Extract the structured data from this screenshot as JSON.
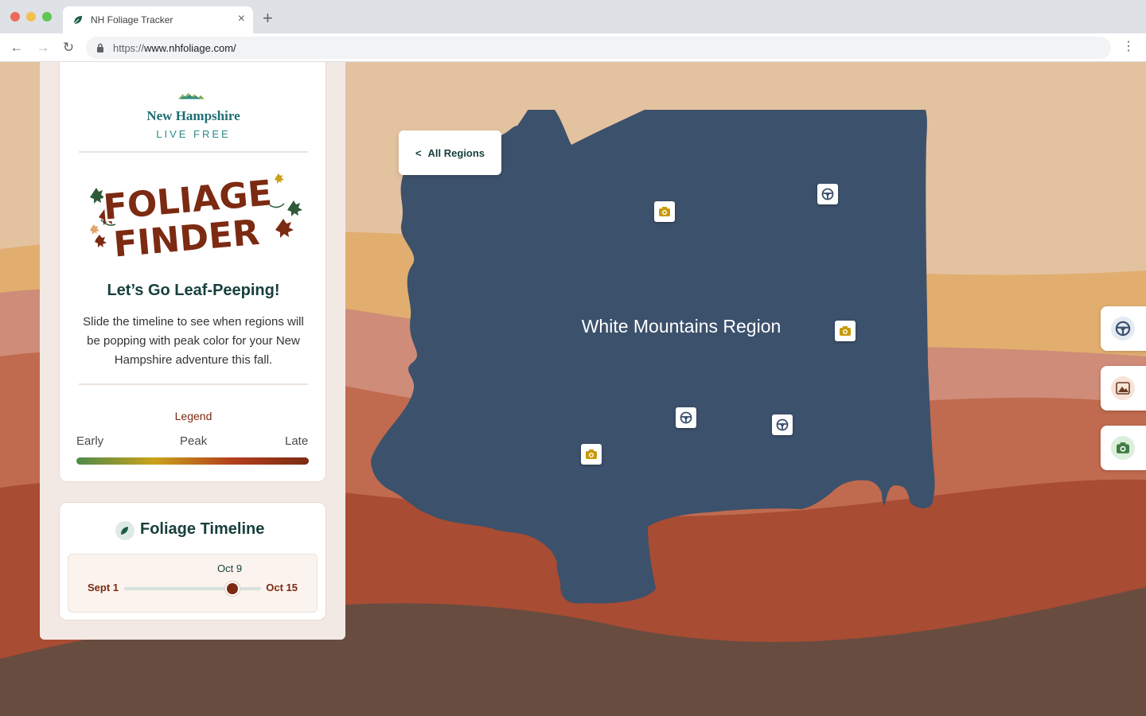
{
  "browser": {
    "tab_title": "NH Foliage Tracker",
    "tab_close": "×",
    "new_tab": "+",
    "url_scheme": "https://",
    "url_host": "www.nhfoliage.com/",
    "nav_back": "←",
    "nav_forward": "→",
    "nav_reload": "↻",
    "menu": "⋮"
  },
  "sidebar": {
    "brand_name": "New Hampshire",
    "brand_motto": "LIVE FREE",
    "logo_line1": "FOLIAGE",
    "logo_line2": "FINDER",
    "headline": "Let’s Go Leaf-Peeping!",
    "description": "Slide the timeline to see when regions will be popping with peak color for your New Hampshire adventure this fall.",
    "legend": {
      "title": "Legend",
      "early": "Early",
      "peak": "Peak",
      "late": "Late",
      "colors": [
        "#4e8a4a",
        "#c9a21b",
        "#b3401d",
        "#7c2a12"
      ]
    }
  },
  "timeline": {
    "title": "Foliage Timeline",
    "current": "Oct 9",
    "start": "Sept 1",
    "end": "Oct 15",
    "value_fraction": 0.79
  },
  "map": {
    "back_label": "All Regions",
    "back_chevron": "<",
    "region_name": "White Mountains Region",
    "region_color": "#3c516c",
    "markers": [
      {
        "icon": "camera-icon"
      },
      {
        "icon": "steering-wheel-icon"
      },
      {
        "icon": "camera-icon"
      },
      {
        "icon": "steering-wheel-icon"
      },
      {
        "icon": "steering-wheel-icon"
      },
      {
        "icon": "camera-icon"
      }
    ]
  },
  "filters": [
    {
      "icon": "steering-wheel-icon",
      "color": "#3c516c"
    },
    {
      "icon": "mountain-icon",
      "color": "#6b3a24"
    },
    {
      "icon": "camera-icon",
      "color": "#3f7d45"
    }
  ]
}
